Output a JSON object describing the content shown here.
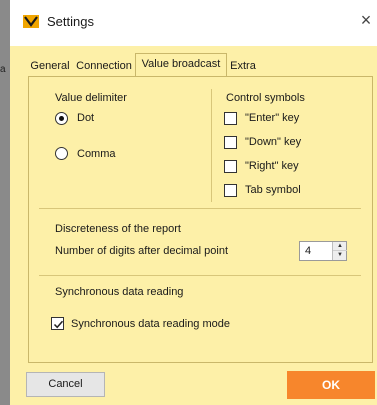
{
  "window": {
    "title": "Settings",
    "close_glyph": "×"
  },
  "left_edge_fragment": "a",
  "tabs": [
    {
      "label": "General",
      "active": false
    },
    {
      "label": "Connection",
      "active": false
    },
    {
      "label": "Value broadcast",
      "active": true
    },
    {
      "label": "Extra",
      "active": false
    }
  ],
  "value_delimiter": {
    "title": "Value delimiter",
    "options": [
      {
        "label": "Dot",
        "selected": true
      },
      {
        "label": "Comma",
        "selected": false
      }
    ]
  },
  "control_symbols": {
    "title": "Control symbols",
    "options": [
      {
        "label": "\"Enter\" key",
        "checked": false
      },
      {
        "label": "\"Down\" key",
        "checked": false
      },
      {
        "label": "\"Right\" key",
        "checked": false
      },
      {
        "label": "Tab symbol",
        "checked": false
      }
    ]
  },
  "discreteness": {
    "title": "Discreteness of the report",
    "digits_label": "Number of digits after decimal point",
    "digits_value": "4"
  },
  "sync": {
    "title": "Synchronous data reading",
    "mode_label": "Synchronous data reading mode",
    "mode_checked": true
  },
  "footer": {
    "cancel_label": "Cancel",
    "ok_label": "OK"
  },
  "colors": {
    "background": "#fdf0a8",
    "ok_button": "#f7862c",
    "app_icon": "#f0a500"
  },
  "icons": {
    "app": "app-logo-icon",
    "close": "close-icon",
    "spin_up": "spin-up-icon",
    "spin_down": "spin-down-icon"
  }
}
